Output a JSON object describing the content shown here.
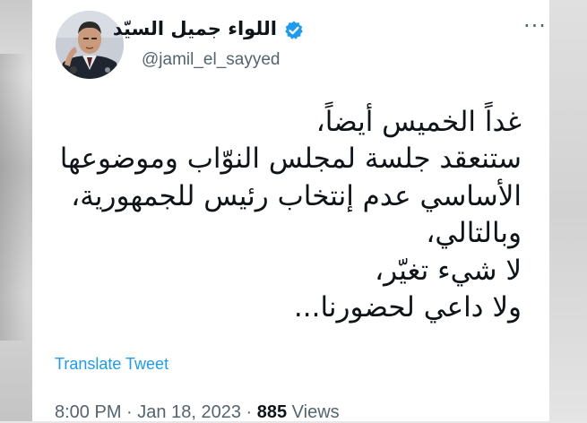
{
  "author": {
    "display_name": "اللواء جميل السيّد",
    "handle": "@jamil_el_sayyed",
    "verified": true,
    "verified_color": "#1d9bf0"
  },
  "tweet": {
    "lines": [
      "غداً الخميس أيضاً،",
      "ستنعقد جلسة لمجلس النوّاب وموضوعها",
      "الأساسي عدم إنتخاب رئيس للجمهورية،",
      "وبالتالي،",
      "لا شيء تغيّر،",
      "ولا داعي لحضورنا..."
    ]
  },
  "actions": {
    "translate_label": "Translate Tweet",
    "more_icon": "more-icon"
  },
  "meta": {
    "time": "8:00 PM",
    "separator": "·",
    "date": "Jan 18, 2023",
    "views_count": "885",
    "views_label": "Views"
  },
  "colors": {
    "text": "#0f1419",
    "secondary": "#536471",
    "link": "#1d9bf0"
  }
}
